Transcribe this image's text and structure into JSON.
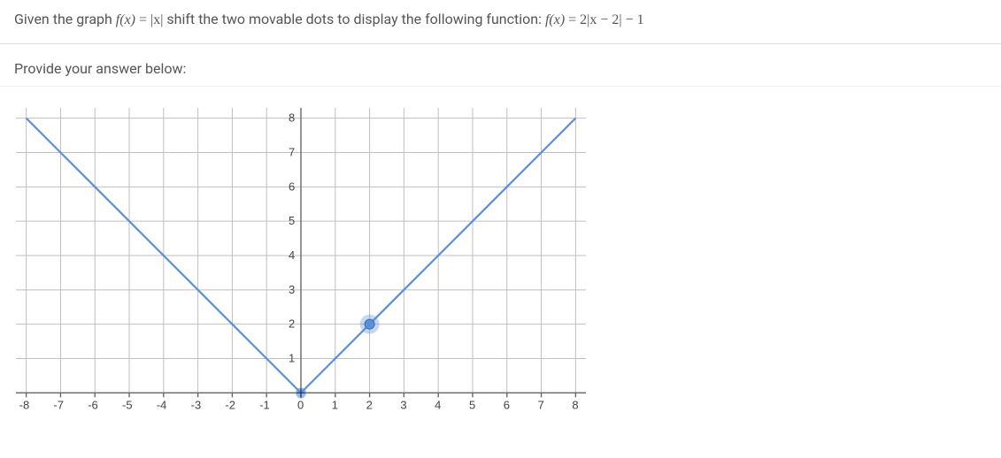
{
  "question": {
    "prefix": "Given the graph ",
    "eq1_lhs": "f(x)",
    "eq1_eq": " = ",
    "eq1_rhs": "|x|",
    "middle": " shift the two movable dots to display the following function: ",
    "eq2_lhs": "f(x)",
    "eq2_eq": " = ",
    "eq2_rhs": "2|x − 2| − 1"
  },
  "answer_prompt": "Provide your answer below:",
  "chart_data": {
    "type": "line",
    "title": "",
    "xlabel": "",
    "ylabel": "",
    "x_ticks": [
      -8,
      -7,
      -6,
      -5,
      -4,
      -3,
      -2,
      -1,
      0,
      1,
      2,
      3,
      4,
      5,
      6,
      7,
      8
    ],
    "y_ticks": [
      1,
      2,
      3,
      4,
      5,
      6,
      7,
      8
    ],
    "xlim": [
      -8.3,
      8.3
    ],
    "ylim": [
      -0.3,
      8.3
    ],
    "series": [
      {
        "name": "abs-x",
        "x": [
          -8,
          -7,
          -6,
          -5,
          -4,
          -3,
          -2,
          -1,
          0,
          1,
          2,
          3,
          4,
          5,
          6,
          7,
          8
        ],
        "y": [
          8,
          7,
          6,
          5,
          4,
          3,
          2,
          1,
          0,
          1,
          2,
          3,
          4,
          5,
          6,
          7,
          8
        ]
      }
    ],
    "dots": [
      {
        "name": "vertex-dot",
        "x": 0,
        "y": 0
      },
      {
        "name": "arm-dot",
        "x": 2,
        "y": 2
      }
    ]
  }
}
